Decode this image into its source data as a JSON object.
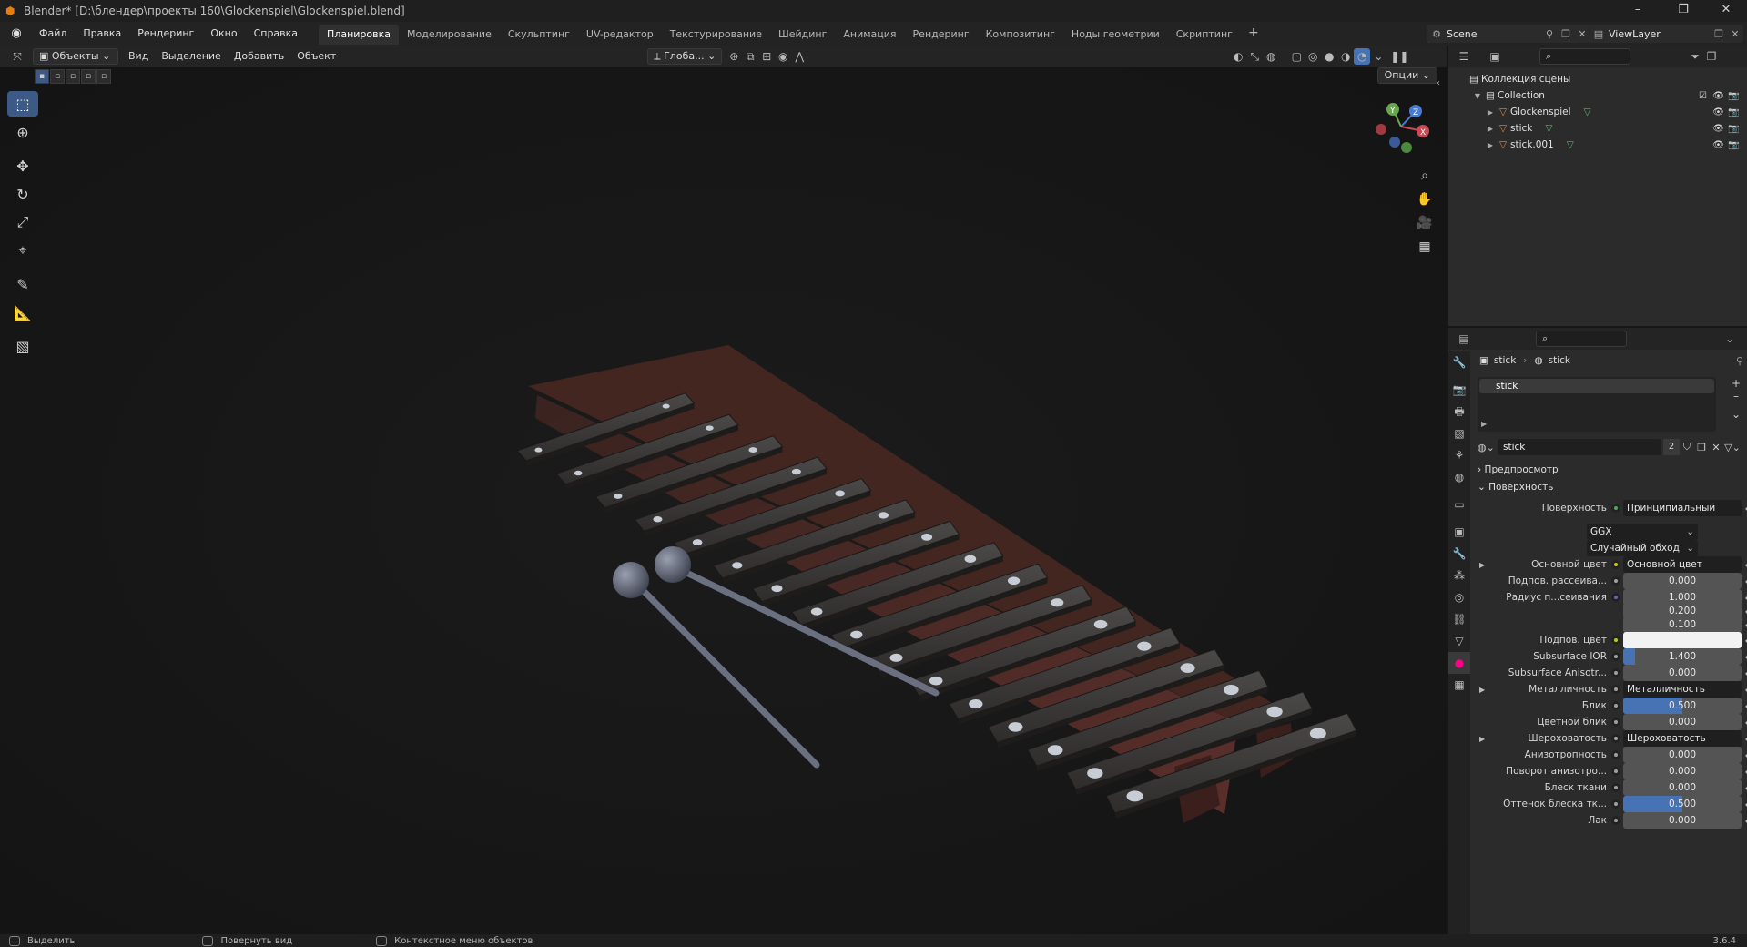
{
  "titlebar": {
    "title": "Blender* [D:\\блендер\\проекты 160\\Glockenspiel\\Glockenspiel.blend]",
    "minimize": "–",
    "maximize": "❐",
    "close": "✕"
  },
  "menu": [
    "Файл",
    "Правка",
    "Рендеринг",
    "Окно",
    "Справка"
  ],
  "workspaces": [
    {
      "label": "Планировка",
      "active": true
    },
    {
      "label": "Моделирование",
      "active": false
    },
    {
      "label": "Скульптинг",
      "active": false
    },
    {
      "label": "UV-редактор",
      "active": false
    },
    {
      "label": "Текстурирование",
      "active": false
    },
    {
      "label": "Шейдинг",
      "active": false
    },
    {
      "label": "Анимация",
      "active": false
    },
    {
      "label": "Рендеринг",
      "active": false
    },
    {
      "label": "Композитинг",
      "active": false
    },
    {
      "label": "Ноды геометрии",
      "active": false
    },
    {
      "label": "Скриптинг",
      "active": false
    }
  ],
  "scene": {
    "label": "Scene",
    "view_layer": "ViewLayer"
  },
  "viewport_header": {
    "mode": "Объекты",
    "menus": [
      "Вид",
      "Выделение",
      "Добавить",
      "Объект"
    ],
    "orientation": "Глоба...",
    "options": "Опции"
  },
  "outliner": {
    "root": "Коллекция сцены",
    "collection": "Collection",
    "objects": [
      "Glockenspiel",
      "stick",
      "stick.001"
    ]
  },
  "properties": {
    "breadcrumb_obj": "stick",
    "breadcrumb_mat": "stick",
    "slot": "stick",
    "material_name": "stick",
    "users": "2",
    "section_preview": "Предпросмотр",
    "section_surface": "Поверхность",
    "rows": [
      {
        "label": "Поверхность",
        "value": "Принципиальный BSDF",
        "type": "link",
        "dot": "green"
      },
      {
        "label": "",
        "value": "GGX",
        "type": "dropdown"
      },
      {
        "label": "",
        "value": "Случайный обход",
        "type": "dropdown"
      },
      {
        "label": "Основной цвет",
        "value": "Основной цвет",
        "type": "link",
        "dot": "yellow",
        "expand": true
      },
      {
        "label": "Подпов. рассеива...",
        "value": "0.000",
        "type": "num",
        "dot": "gray"
      },
      {
        "label": "Радиус п...сеивания",
        "value": "1.000",
        "type": "num",
        "dot": "blue"
      },
      {
        "label": "",
        "value": "0.200",
        "type": "num"
      },
      {
        "label": "",
        "value": "0.100",
        "type": "num"
      },
      {
        "label": "Подпов. цвет",
        "value": "",
        "type": "color",
        "dot": "yellow"
      },
      {
        "label": "Subsurface IOR",
        "value": "1.400",
        "type": "num",
        "dot": "gray",
        "fill": 0.1
      },
      {
        "label": "Subsurface Anisotr...",
        "value": "0.000",
        "type": "num",
        "dot": "gray"
      },
      {
        "label": "Металличность",
        "value": "Металличность",
        "type": "link",
        "dot": "gray",
        "expand": true
      },
      {
        "label": "Блик",
        "value": "0.500",
        "type": "num",
        "dot": "gray",
        "fill": 0.5
      },
      {
        "label": "Цветной блик",
        "value": "0.000",
        "type": "num",
        "dot": "gray"
      },
      {
        "label": "Шероховатость",
        "value": "Шероховатость",
        "type": "link",
        "dot": "gray",
        "expand": true
      },
      {
        "label": "Анизотропность",
        "value": "0.000",
        "type": "num",
        "dot": "gray"
      },
      {
        "label": "Поворот анизотро...",
        "value": "0.000",
        "type": "num",
        "dot": "gray"
      },
      {
        "label": "Блеск ткани",
        "value": "0.000",
        "type": "num",
        "dot": "gray"
      },
      {
        "label": "Оттенок блеска тк...",
        "value": "0.500",
        "type": "num",
        "dot": "gray",
        "fill": 0.5
      },
      {
        "label": "Лак",
        "value": "0.000",
        "type": "num",
        "dot": "gray"
      }
    ]
  },
  "statusbar": {
    "select": "Выделить",
    "rotate": "Повернуть вид",
    "context": "Контекстное меню объектов",
    "version": "3.6.4"
  },
  "colors": {
    "accent": "#4772b3",
    "active_tool": "#3d5a86",
    "bg": "#1d1d1d"
  }
}
